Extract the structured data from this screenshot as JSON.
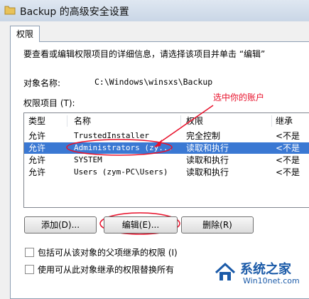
{
  "window": {
    "title": "Backup 的高级安全设置"
  },
  "tab": {
    "label": "权限"
  },
  "description": "要查看或编辑权限项目的详细信息，请选择该项目并单击 “编辑”",
  "object": {
    "label": "对象名称:",
    "value": "C:\\Windows\\winsxs\\Backup"
  },
  "entries": {
    "label": "权限项目 (T):",
    "columns": [
      "类型",
      "名称",
      "权限",
      "继承"
    ],
    "rows": [
      {
        "type": "允许",
        "name": "TrustedInstaller",
        "perm": "完全控制",
        "inherit": "<不是"
      },
      {
        "type": "允许",
        "name": "Administrators (zy...",
        "perm": "读取和执行",
        "inherit": "<不是",
        "selected": true
      },
      {
        "type": "允许",
        "name": "SYSTEM",
        "perm": "读取和执行",
        "inherit": "<不是"
      },
      {
        "type": "允许",
        "name": "Users (zym-PC\\Users)",
        "perm": "读取和执行",
        "inherit": "<不是"
      }
    ]
  },
  "annotation": {
    "text": "选中你的账户",
    "color": "#e8102a"
  },
  "buttons": {
    "add": "添加(D)...",
    "edit": "编辑(E)...",
    "remove": "删除(R)"
  },
  "checkboxes": [
    {
      "label": "包括可从该对象的父项继承的权限 (I)",
      "checked": false
    },
    {
      "label": "使用可从此对象继承的权限替换所有",
      "checked": false
    }
  ],
  "watermark": {
    "name": "系统之家",
    "url": "Win10net.com"
  },
  "colors": {
    "selection": "#3a78d3",
    "titlebar": "#dfe7f1"
  }
}
